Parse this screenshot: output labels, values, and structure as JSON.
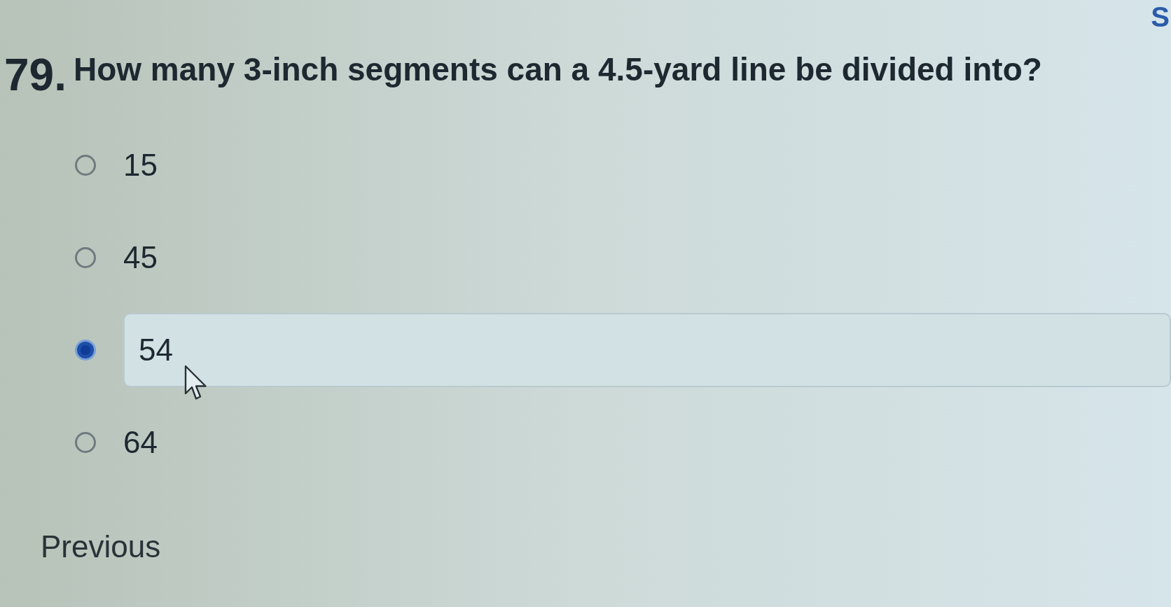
{
  "header": {
    "partial_text": "S"
  },
  "question": {
    "number": "79.",
    "text": "How many 3-inch segments can a 4.5-yard line be divided into?"
  },
  "options": [
    {
      "label": "15",
      "selected": false
    },
    {
      "label": "45",
      "selected": false
    },
    {
      "label": "54",
      "selected": true
    },
    {
      "label": "64",
      "selected": false
    }
  ],
  "navigation": {
    "previous": "Previous"
  }
}
